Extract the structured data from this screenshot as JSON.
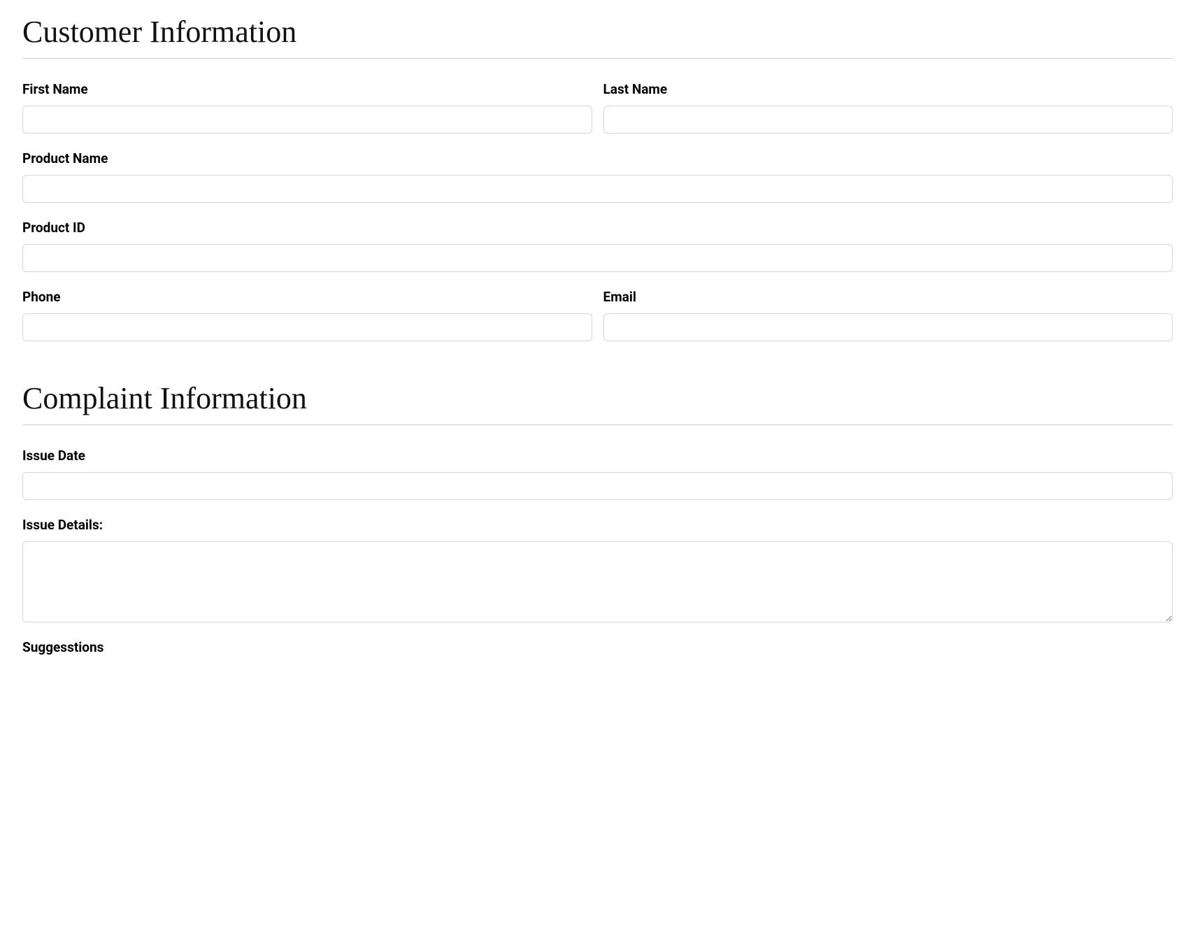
{
  "customer": {
    "title": "Customer Information",
    "fields": {
      "first_name": {
        "label": "First Name",
        "value": ""
      },
      "last_name": {
        "label": "Last Name",
        "value": ""
      },
      "product_name": {
        "label": "Product Name",
        "value": ""
      },
      "product_id": {
        "label": "Product ID",
        "value": ""
      },
      "phone": {
        "label": "Phone",
        "value": ""
      },
      "email": {
        "label": "Email",
        "value": ""
      }
    }
  },
  "complaint": {
    "title": "Complaint Information",
    "fields": {
      "issue_date": {
        "label": "Issue Date",
        "value": ""
      },
      "issue_details": {
        "label": "Issue Details:",
        "value": ""
      },
      "suggestions": {
        "label": "Suggesstions",
        "value": ""
      }
    }
  }
}
